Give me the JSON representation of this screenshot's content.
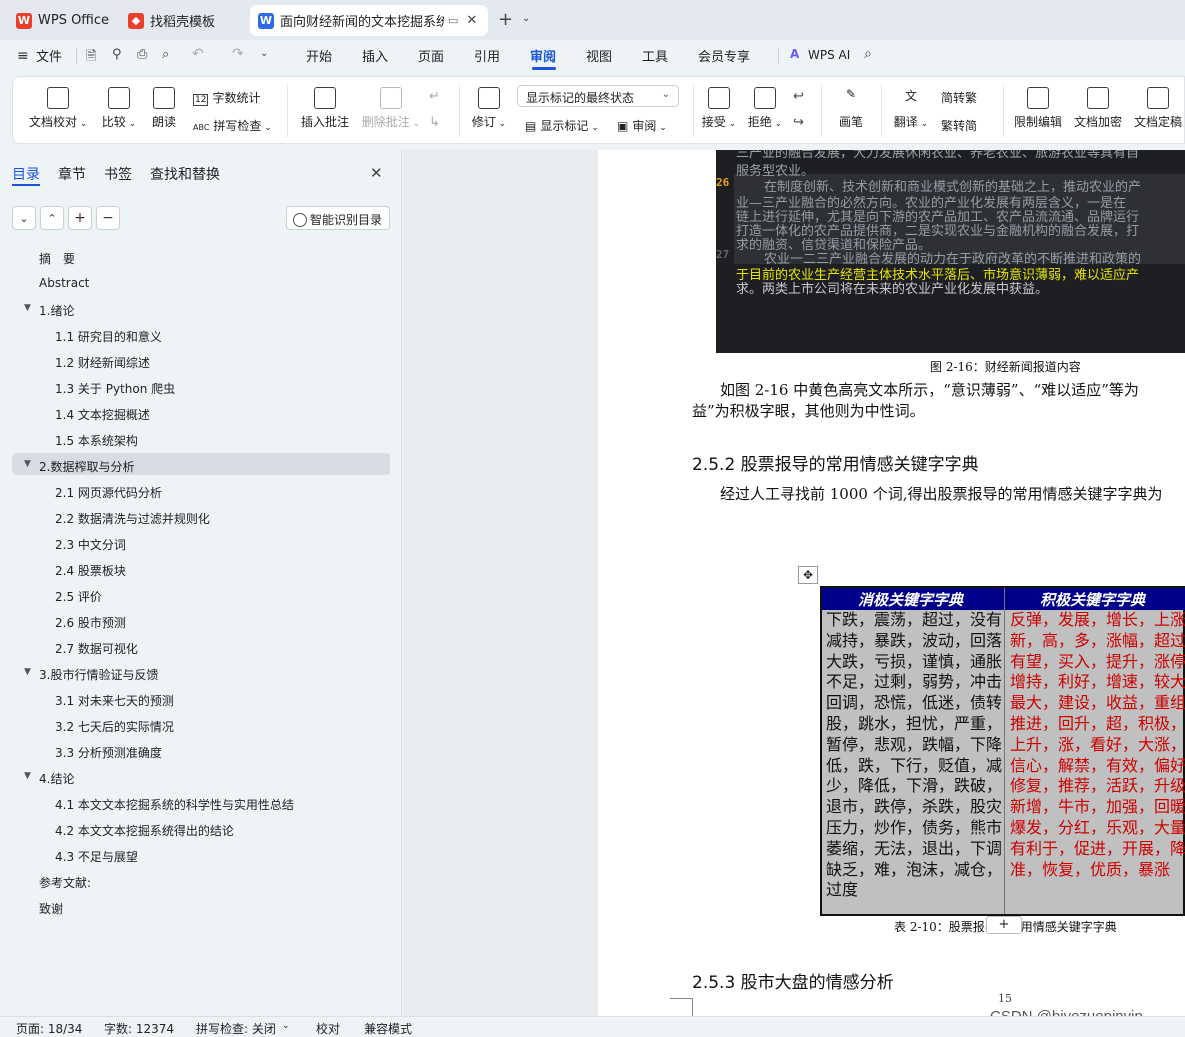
{
  "tabs": [
    {
      "label": "WPS Office"
    },
    {
      "label": "找稻壳模板"
    },
    {
      "label": "面向财经新闻的文本挖掘系统"
    }
  ],
  "menu": {
    "file": "文件",
    "items": [
      "开始",
      "插入",
      "页面",
      "引用",
      "审阅",
      "视图",
      "工具",
      "会员专享"
    ],
    "active": "审阅",
    "wpsai": "WPS AI"
  },
  "ribbon": {
    "doc_check": "文档校对",
    "compare": "比较",
    "read": "朗读",
    "word_count": "字数统计",
    "spell": "拼写检查",
    "insert_comment": "插入批注",
    "delete_comment": "删除批注",
    "revise": "修订",
    "markup_select": "显示标记的最终状态",
    "show_markup": "显示标记",
    "review": "审阅",
    "accept": "接受",
    "reject": "拒绝",
    "pen": "画笔",
    "translate": "翻译",
    "to_trad": "简转繁",
    "to_simp": "繁转简",
    "restrict": "限制编辑",
    "encrypt": "文档加密",
    "finalize": "文档定稿"
  },
  "panel": {
    "tabs": [
      "目录",
      "章节",
      "书签",
      "查找和替换"
    ],
    "active": "目录",
    "smart_btn": "智能识别目录"
  },
  "toc": [
    {
      "text": "摘　要",
      "level": 0
    },
    {
      "text": "Abstract",
      "level": 0
    },
    {
      "text": "1.绪论",
      "level": 0,
      "arrow": true
    },
    {
      "text": "1.1  研究目的和意义",
      "level": 1
    },
    {
      "text": "1.2  财经新闻综述",
      "level": 1
    },
    {
      "text": "1.3  关于 Python 爬虫",
      "level": 1
    },
    {
      "text": "1.4  文本挖掘概述",
      "level": 1
    },
    {
      "text": "1.5 本系统架构",
      "level": 1
    },
    {
      "text": "2.数据榨取与分析",
      "level": 0,
      "arrow": true,
      "selected": true
    },
    {
      "text": "2.1  网页源代码分析",
      "level": 1
    },
    {
      "text": "2.2  数据清洗与过滤并规则化",
      "level": 1
    },
    {
      "text": "2.3  中文分词",
      "level": 1
    },
    {
      "text": "2.4  股票板块",
      "level": 1
    },
    {
      "text": "2.5  评价",
      "level": 1
    },
    {
      "text": "2.6  股市预测",
      "level": 1
    },
    {
      "text": "2.7  数据可视化",
      "level": 1
    },
    {
      "text": "3.股市行情验证与反馈",
      "level": 0,
      "arrow": true
    },
    {
      "text": "3.1  对未来七天的预测",
      "level": 1
    },
    {
      "text": "3.2  七天后的实际情况",
      "level": 1
    },
    {
      "text": "3.3  分析预测准确度",
      "level": 1
    },
    {
      "text": "4.结论",
      "level": 0,
      "arrow": true
    },
    {
      "text": "4.1  本文文本挖掘系统的科学性与实用性总结",
      "level": 1
    },
    {
      "text": "4.2  本文文本挖掘系统得出的结论",
      "level": 1
    },
    {
      "text": "4.3  不足与展望",
      "level": 1
    },
    {
      "text": "参考文献:",
      "level": 0
    },
    {
      "text": "致谢",
      "level": 0
    }
  ],
  "doc": {
    "code_lines": [
      "三产业的融合发展，大力发展休闲农业、养老农业、旅游农业等具有自",
      "服务型农业。",
      "在制度创新、技术创新和商业模式创新的基础之上，推动农业的产",
      "业—三产业融合的必然方向。农业的产业化发展有两层含义，一是在",
      "链上进行延伸，尤其是向下游的农产品加工、农产品流流通、品牌运行",
      "打造一体化的农产品提供商，二是实现农业与金融机构的融合发展，打",
      "求的融资、信贷渠道和保险产品。",
      "农业一二三产业融合发展的动力在于政府改革的不断推进和政策的",
      "于目前的农业生产经营主体技术水平落后、市场意识薄弱，难以适应产",
      "求。两类上市公司将在未来的农业产业化发展中获益。"
    ],
    "code_line_nums": [
      "26",
      "27"
    ],
    "fig_caption": "图 2-16：财经新闻报道内容",
    "para1_line1": "如图 2-16 中黄色高亮文本所示，“意识薄弱”、“难以适应”等为",
    "para1_line2": "益”为积极字眼，其他则为中性词。",
    "h252": "2.5.2  股票报导的常用情感关键字字典",
    "para2": "经过人工寻找前 1000 个词,得出股票报导的常用情感关键字字典为",
    "table_header": [
      "消极关键字字典",
      "积极关键字字典"
    ],
    "neg_lines": [
      "下跌，震荡，超过，没有，",
      "减持，暴跌，波动，回落，",
      "大跌，亏损，谨慎，通胀，",
      "不足，过剩，弱势，冲击，",
      "回调，恐慌，低迷，债转",
      "股，跳水，担忧，严重，",
      "暂停，悲观，跌幅，下降，",
      "低，跌，下行，贬值，减",
      "少，降低，下滑，跌破，",
      "退市，跌停，杀跌，股灾，",
      "压力，炒作，债务，熊市，",
      "萎缩，无法，退出，下调，",
      "缺乏，难，泡沫，减仓，",
      "过度"
    ],
    "pos_lines": [
      "反弹，发展，增长，上涨，",
      "新，高，多，涨幅，超过，",
      "有望，买入，提升，涨停，",
      "增持，利好，增速，较大，",
      "最大，建设，收益，重组，",
      "推进，回升，超，积极，",
      "上升，涨，看好，大涨，",
      "信心，解禁，有效，偏好，",
      "修复，推荐，活跃，升级，",
      "新增，牛市，加强，回暖，",
      "爆发，分红，乐观，大量，",
      "有利于，促进，开展，降",
      "准，恢复，优质，暴涨"
    ],
    "table_caption": "表 2-10：股票报导的常用情感关键字字典",
    "h253": "2.5.3  股市大盘的情感分析",
    "page_num": "15",
    "watermark": "CSDN @biyezuopinvip"
  },
  "status": {
    "page": "页面: 18/34",
    "words": "字数: 12374",
    "spell": "拼写检查: 关闭",
    "proof": "校对",
    "compat": "兼容模式"
  },
  "colors": {
    "accent": "#1a56db",
    "neg_text": "#111111",
    "pos_text": "#cc0000",
    "table_header_bg": "#00008b",
    "code_bg": "#1e1f22",
    "highlight": "#e6e600"
  }
}
